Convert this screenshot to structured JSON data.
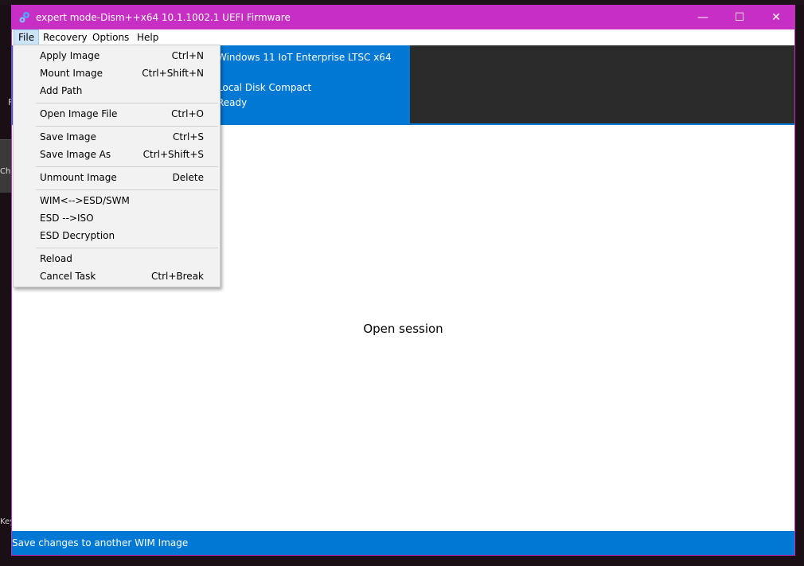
{
  "window": {
    "title": "expert mode-Dism++x64 10.1.1002.1 UEFI Firmware",
    "controls": {
      "minimize": "—",
      "maximize": "☐",
      "close": "✕"
    }
  },
  "menubar": [
    "File",
    "Recovery",
    "Options",
    "Help"
  ],
  "banner": {
    "os": "Windows 11 IoT Enterprise LTSC x64",
    "dash": "-",
    "disk": "Local Disk Compact",
    "status": "Ready"
  },
  "main": {
    "open_session": "Open session"
  },
  "statusbar": {
    "text": "Save changes to another WIM Image"
  },
  "file_menu": {
    "items": [
      {
        "label": "Apply Image",
        "shortcut": "Ctrl+N"
      },
      {
        "label": "Mount Image",
        "shortcut": "Ctrl+Shift+N"
      },
      {
        "label": "Add Path",
        "shortcut": ""
      },
      {
        "label": "Open Image File",
        "shortcut": "Ctrl+O"
      },
      {
        "label": "Save Image",
        "shortcut": "Ctrl+S"
      },
      {
        "label": "Save Image As",
        "shortcut": "Ctrl+Shift+S"
      },
      {
        "label": "Unmount Image",
        "shortcut": "Delete"
      },
      {
        "label": "WIM<-->ESD/SWM",
        "shortcut": ""
      },
      {
        "label": "ESD -->ISO",
        "shortcut": ""
      },
      {
        "label": "ESD Decryption",
        "shortcut": ""
      },
      {
        "label": "Reload",
        "shortcut": ""
      },
      {
        "label": "Cancel Task",
        "shortcut": "Ctrl+Break"
      }
    ]
  },
  "desktop": {
    "f_label": "F",
    "item_text": "Cha",
    "key_text": "Key"
  },
  "colors": {
    "titlebar": "#c72fc4",
    "accent_blue": "#0078d4",
    "banner_dark": "#2b2b2b",
    "menu_bg": "#f2f2f2"
  }
}
